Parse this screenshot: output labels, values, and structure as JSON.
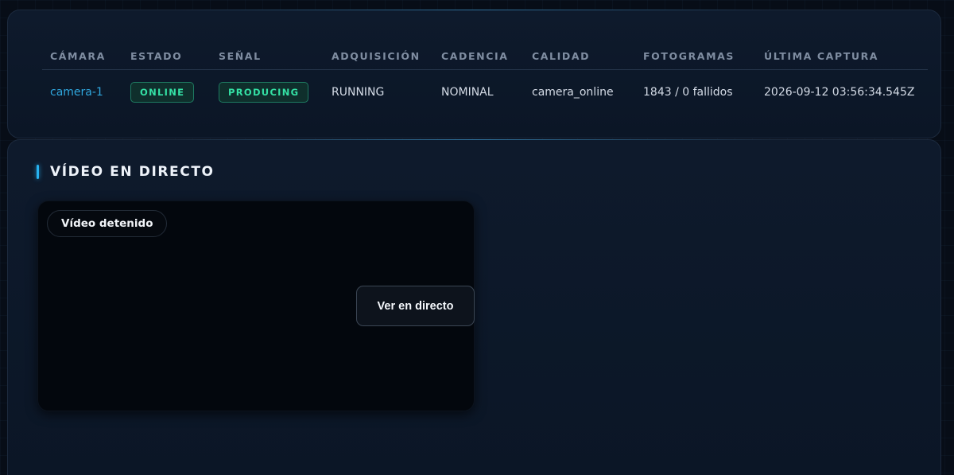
{
  "status_table": {
    "headers": [
      "CÁMARA",
      "ESTADO",
      "SEÑAL",
      "ADQUISICIÓN",
      "CADENCIA",
      "CALIDAD",
      "FOTOGRAMAS",
      "ÚLTIMA CAPTURA"
    ],
    "row": {
      "camera": "camera-1",
      "estado": "ONLINE",
      "senal": "PRODUCING",
      "adquisicion": "RUNNING",
      "cadencia": "NOMINAL",
      "calidad": "camera_online",
      "fotogramas": "1843 / 0 fallidos",
      "ultima_captura": "2026-09-12 03:56:34.545Z"
    }
  },
  "video": {
    "title": "VÍDEO EN DIRECTO",
    "status_pill": "Vídeo detenido",
    "live_button": "Ver en directo"
  },
  "colors": {
    "accent": "#27b2f0",
    "camera_link": "#2fa7de",
    "badge_text": "#34e0a4",
    "badge_border": "#1e7a61",
    "background": "#070d17"
  }
}
